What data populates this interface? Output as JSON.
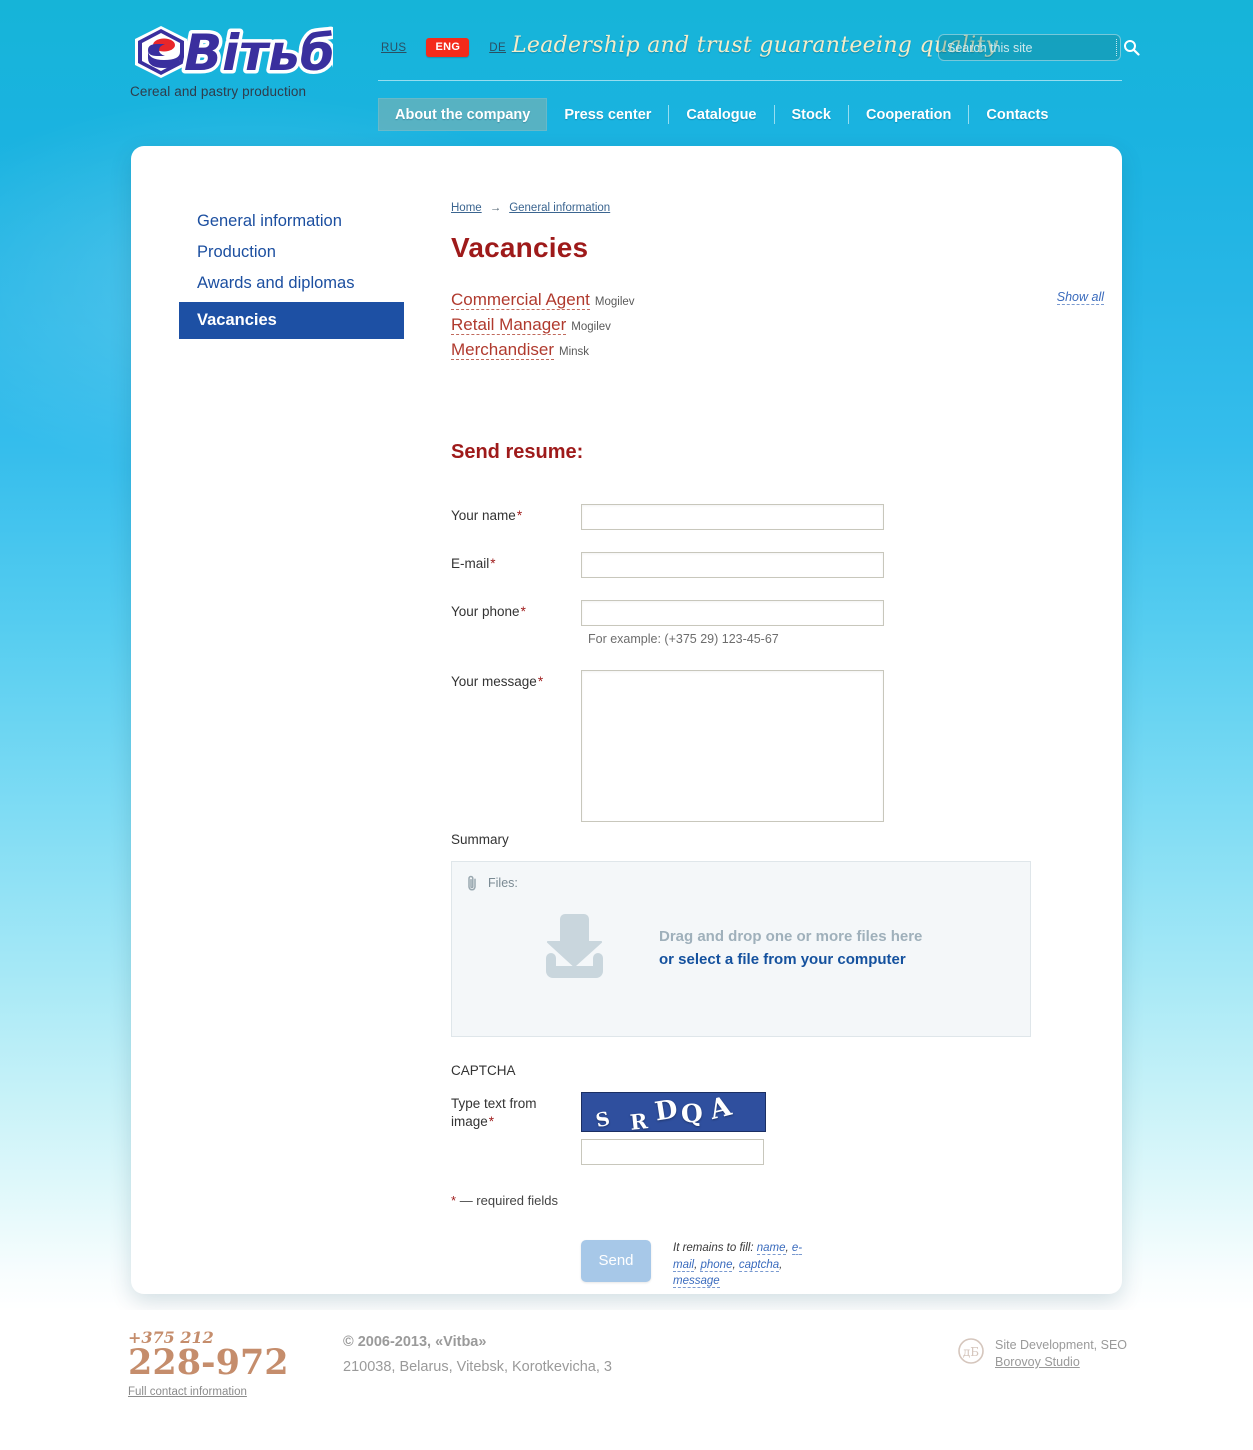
{
  "site": {
    "logo_text": "Вiтьба",
    "logo_tagline": "Cereal and pastry production",
    "slogan": "Leadership and trust guaranteeing quality"
  },
  "header": {
    "languages": [
      {
        "code": "RUS",
        "active": false
      },
      {
        "code": "ENG",
        "active": true
      },
      {
        "code": "DE",
        "active": false
      }
    ],
    "search": {
      "placeholder": "Search this site",
      "value": "",
      "icon": "search-icon"
    }
  },
  "nav": {
    "items": [
      {
        "label": "About the company",
        "active": true
      },
      {
        "label": "Press center",
        "active": false
      },
      {
        "label": "Catalogue",
        "active": false
      },
      {
        "label": "Stock",
        "active": false
      },
      {
        "label": "Cooperation",
        "active": false
      },
      {
        "label": "Contacts",
        "active": false
      }
    ]
  },
  "sidebar": {
    "items": [
      {
        "label": "General information",
        "active": false
      },
      {
        "label": "Production",
        "active": false
      },
      {
        "label": "Awards and diplomas",
        "active": false
      },
      {
        "label": "Vacancies",
        "active": true
      }
    ]
  },
  "breadcrumb": {
    "home": "Home",
    "arrow": "→",
    "current": "General information"
  },
  "page": {
    "title": "Vacancies",
    "show_all": "Show all"
  },
  "vacancies": [
    {
      "title": "Commercial Agent",
      "city": "Mogilev"
    },
    {
      "title": "Retail Manager",
      "city": "Mogilev"
    },
    {
      "title": "Merchandiser",
      "city": "Minsk"
    }
  ],
  "form": {
    "title": "Send resume:",
    "name": {
      "label": "Your name",
      "required": "*",
      "value": ""
    },
    "email": {
      "label": "E-mail",
      "required": "*",
      "value": ""
    },
    "phone": {
      "label": "Your phone",
      "required": "*",
      "value": "",
      "hint": "For example: (+375 29) 123-45-67"
    },
    "message": {
      "label": "Your message",
      "required": "*",
      "value": ""
    },
    "summary_label": "Summary",
    "dropzone": {
      "files_label": "Files:",
      "clip_icon": "paperclip-icon",
      "download_icon": "download-icon",
      "drag_text": "Drag and drop one or more files here",
      "select_link": "or select a file from your computer"
    },
    "captcha": {
      "section_label": "CAPTCHA",
      "label": "Type text from image",
      "required": "*",
      "image_text": "S R D Q A",
      "image_chars": [
        "S",
        "R",
        "D",
        "Q",
        "A"
      ],
      "input_value": ""
    },
    "required_note_star": "*",
    "required_note": "— required fields",
    "send_label": "Send",
    "remains_prefix": "It remains to fill:",
    "remains_tokens": [
      "name",
      "e-mail",
      "phone",
      "captcha",
      "message"
    ]
  },
  "footer": {
    "phone_code": "+375 212",
    "phone_number": "228-972",
    "full_contact": "Full contact information",
    "copyright": "© 2006-2013, «Vitba»",
    "address": "210038, Belarus, Vitebsk, Korotkevicha, 3",
    "dev_line1": "Site Development, SEO",
    "dev_line2": "Borovoy Studio",
    "dev_logo_icon": "borovoy-logo-icon"
  },
  "colors": {
    "brand_blue": "#3a2f9e",
    "brand_red": "#e8262a",
    "accent_red": "#9e1a1a",
    "link_blue": "#1c4fa0",
    "sidebar_active": "#1d50a4",
    "captcha_bg": "#2f4f9e",
    "phone_bronze": "#c58d6c"
  }
}
